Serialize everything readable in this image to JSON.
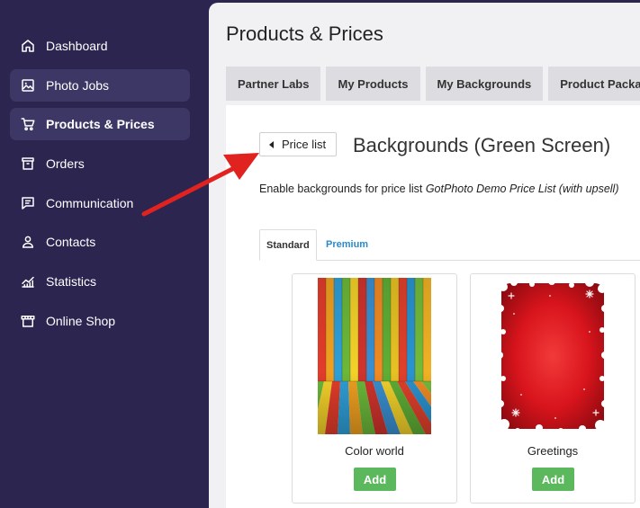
{
  "sidebar": {
    "items": [
      {
        "label": "Dashboard",
        "icon": "home-icon",
        "state": "normal"
      },
      {
        "label": "Photo Jobs",
        "icon": "image-icon",
        "state": "hover"
      },
      {
        "label": "Products & Prices",
        "icon": "cart-icon",
        "state": "active"
      },
      {
        "label": "Orders",
        "icon": "box-icon",
        "state": "normal"
      },
      {
        "label": "Communication",
        "icon": "message-icon",
        "state": "normal"
      },
      {
        "label": "Contacts",
        "icon": "user-icon",
        "state": "normal"
      },
      {
        "label": "Statistics",
        "icon": "chart-icon",
        "state": "normal"
      },
      {
        "label": "Online Shop",
        "icon": "store-icon",
        "state": "normal"
      }
    ]
  },
  "main": {
    "title": "Products & Prices",
    "tabs": [
      {
        "label": "Partner Labs"
      },
      {
        "label": "My Products"
      },
      {
        "label": "My Backgrounds"
      },
      {
        "label": "Product Packages"
      }
    ],
    "back_button": "Price list",
    "section_title": "Backgrounds (Green Screen)",
    "enable_prefix": "Enable backgrounds for price list ",
    "enable_pricelist": "GotPhoto Demo Price List (with upsell)",
    "subtabs": [
      {
        "label": "Standard",
        "active": true
      },
      {
        "label": "Premium",
        "active": false
      }
    ],
    "backgrounds": [
      {
        "name": "Color world",
        "add_label": "Add"
      },
      {
        "name": "Greetings",
        "add_label": "Add"
      }
    ]
  },
  "colors": {
    "sidebar_bg": "#2b2550",
    "accent_link": "#2a8bcc",
    "add_button": "#5cb85c",
    "annotation_arrow": "#e0231f"
  }
}
